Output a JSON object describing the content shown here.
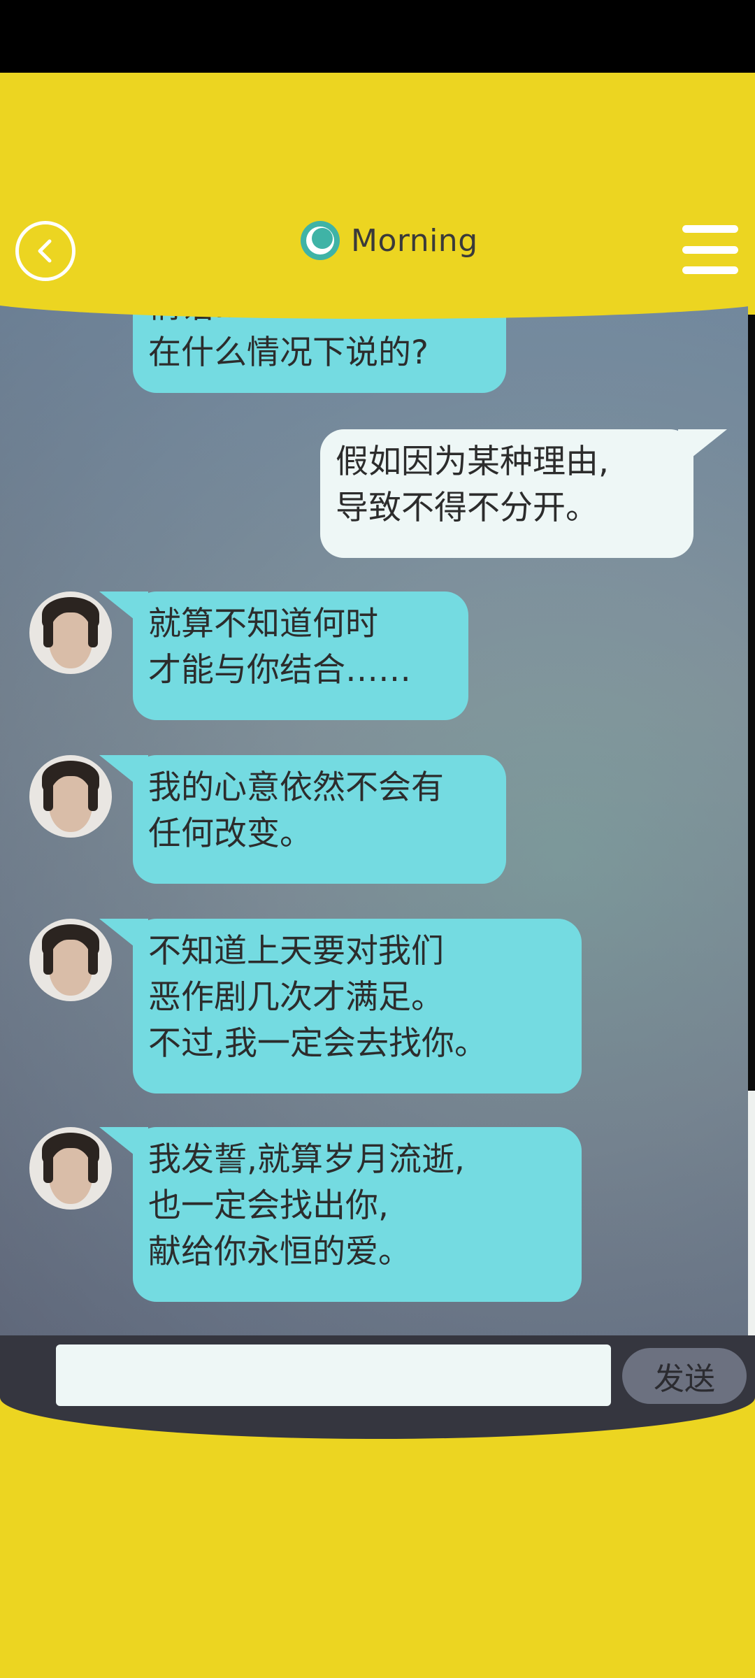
{
  "header": {
    "title": "Morning",
    "title_icon": "sun-gear-icon",
    "back_icon": "chevron-left-icon",
    "menu_icon": "hamburger-menu-icon"
  },
  "messages": [
    {
      "side": "left",
      "text": "情话……\n在什么情况下说的?"
    },
    {
      "side": "right",
      "text": "假如因为某种理由,\n导致不得不分开。"
    },
    {
      "side": "left",
      "text": "就算不知道何时\n才能与你结合……"
    },
    {
      "side": "left",
      "text": "我的心意依然不会有\n任何改变。"
    },
    {
      "side": "left",
      "text": "不知道上天要对我们\n恶作剧几次才满足。\n不过,我一定会去找你。"
    },
    {
      "side": "left",
      "text": "我发誓,就算岁月流逝,\n也一定会找出你,\n献给你永恒的爱。"
    }
  ],
  "composer": {
    "input_value": "",
    "send_label": "发送"
  },
  "colors": {
    "accent_yellow": "#ecd521",
    "bubble_left": "#74dbe1",
    "bubble_right": "#eef7f6",
    "bar_dark": "#35363f"
  }
}
